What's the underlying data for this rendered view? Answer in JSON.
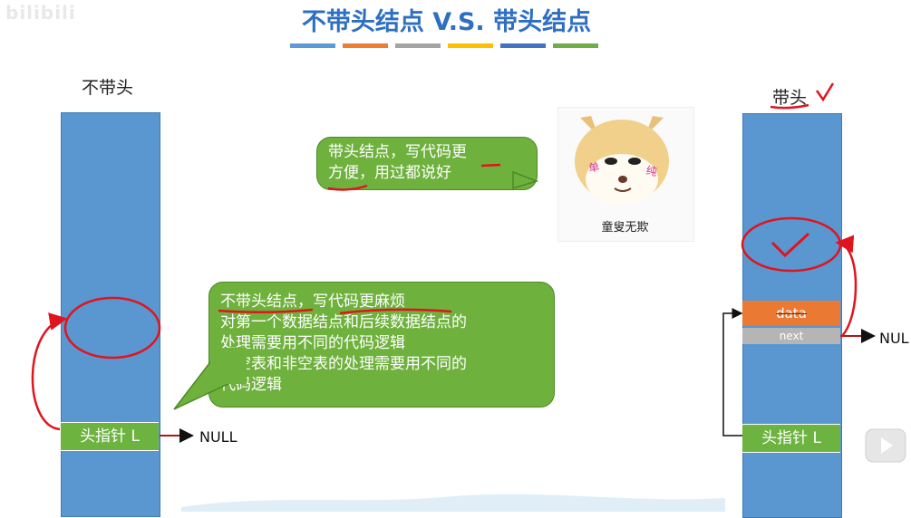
{
  "slide": {
    "watermark": "bilibili",
    "title": "不带头结点 V.S. 带头结点",
    "accent_bar_colors": [
      "#5b9bd5",
      "#ed7d31",
      "#a5a5a5",
      "#ffc000",
      "#4472c4",
      "#70ad47"
    ]
  },
  "left_diagram": {
    "label": "不带头",
    "pointer_label": "头指针 L",
    "null_label": "NULL"
  },
  "right_diagram": {
    "label": "带头",
    "data_label": "data",
    "next_label": "next",
    "null_label": "NUL",
    "pointer_label": "头指针 L"
  },
  "bubbles": {
    "top_line1": "带头结点，写代码更",
    "top_line2": "方便，用过都说好",
    "big_line1": "不带头结点，写代码更麻烦",
    "big_line2": "对第一个数据结点和后续数据结点的",
    "big_line3": "处理需要用不同的代码逻辑",
    "big_line4": "对空表和非空表的处理需要用不同的",
    "big_line5": "代码逻辑"
  },
  "meme": {
    "caption": "童叟无欺"
  },
  "colors": {
    "title_blue": "#2e6fc2",
    "column_blue": "#5a96d0",
    "pointer_green": "#6db33f",
    "data_orange": "#ea7a33",
    "next_gray": "#b5b5b5",
    "annotation_red": "#e0141e"
  }
}
